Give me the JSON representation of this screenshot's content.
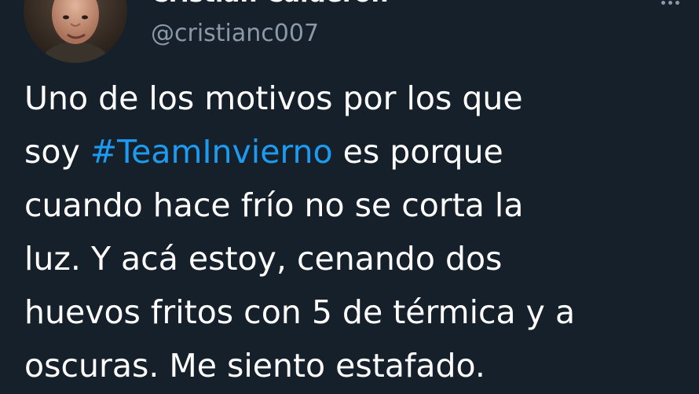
{
  "author": {
    "display_name": "Cristian Calderon",
    "handle": "@cristianc007",
    "avatar_icon": "profile-photo"
  },
  "tweet": {
    "line_1": "Uno de los motivos por los que",
    "line_2_before": "soy ",
    "hashtag": "#TeamInvierno",
    "line_2_after": " es porque",
    "line_3": "cuando hace frío no se corta la",
    "line_4": "luz. Y acá estoy, cenando dos",
    "line_5": "huevos fritos con 5 de térmica y a",
    "line_6": "oscuras. Me siento estafado."
  },
  "colors": {
    "background": "#15202b",
    "text": "#ffffff",
    "secondary_text": "#8b98a5",
    "hashtag": "#1d9bf0"
  },
  "icons": {
    "more": "more-icon"
  }
}
